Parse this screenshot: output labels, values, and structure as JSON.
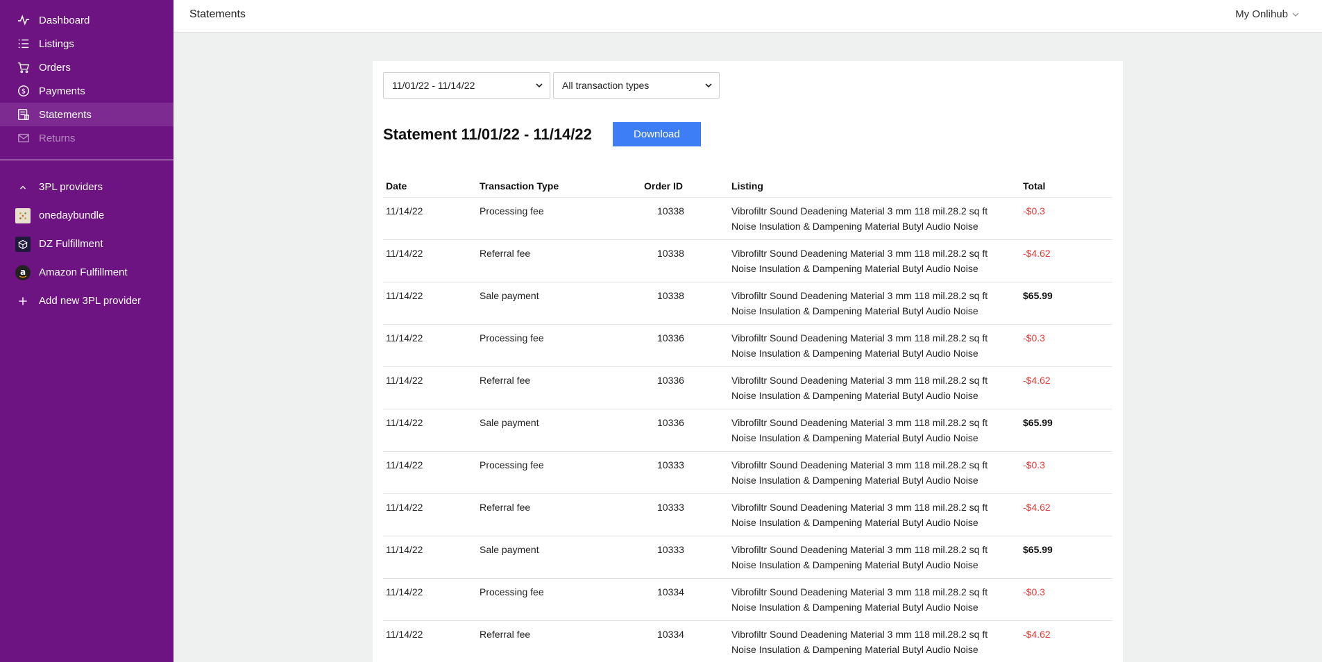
{
  "sidebar": {
    "nav": [
      {
        "label": "Dashboard",
        "icon": "activity-icon"
      },
      {
        "label": "Listings",
        "icon": "list-icon"
      },
      {
        "label": "Orders",
        "icon": "cart-icon"
      },
      {
        "label": "Payments",
        "icon": "dollar-circle-icon"
      },
      {
        "label": "Statements",
        "icon": "statement-icon",
        "active": true
      },
      {
        "label": "Returns",
        "icon": "return-mail-icon",
        "disabled": true
      }
    ],
    "providers_header": "3PL providers",
    "providers": [
      {
        "label": "onedaybundle",
        "icon": "onedaybundle-logo"
      },
      {
        "label": "DZ Fulfillment",
        "icon": "dz-fulfillment-logo"
      },
      {
        "label": "Amazon Fulfillment",
        "icon": "amazon-logo"
      }
    ],
    "add_provider": "Add new 3PL provider"
  },
  "header": {
    "title": "Statements",
    "account": "My Onlihub"
  },
  "filters": {
    "date_range": "11/01/22 - 11/14/22",
    "transaction_type": "All transaction types"
  },
  "statement": {
    "title": "Statement 11/01/22 - 11/14/22",
    "download_label": "Download"
  },
  "table": {
    "headers": [
      "Date",
      "Transaction Type",
      "Order ID",
      "Listing",
      "Total"
    ],
    "rows": [
      {
        "date": "11/14/22",
        "type": "Processing fee",
        "order": "10338",
        "listing_1": "Vibrofiltr Sound Deadening Material 3 mm 118 mil.28.2 sq ft",
        "listing_2": "Noise Insulation & Dampening Material Butyl Audio Noise",
        "total": "-$0.3"
      },
      {
        "date": "11/14/22",
        "type": "Referral fee",
        "order": "10338",
        "listing_1": "Vibrofiltr Sound Deadening Material 3 mm 118 mil.28.2 sq ft",
        "listing_2": "Noise Insulation & Dampening Material Butyl Audio Noise",
        "total": "-$4.62"
      },
      {
        "date": "11/14/22",
        "type": "Sale payment",
        "order": "10338",
        "listing_1": "Vibrofiltr Sound Deadening Material 3 mm 118 mil.28.2 sq ft",
        "listing_2": "Noise Insulation & Dampening Material Butyl Audio Noise",
        "total": "$65.99"
      },
      {
        "date": "11/14/22",
        "type": "Processing fee",
        "order": "10336",
        "listing_1": "Vibrofiltr Sound Deadening Material 3 mm 118 mil.28.2 sq ft",
        "listing_2": "Noise Insulation & Dampening Material Butyl Audio Noise",
        "total": "-$0.3"
      },
      {
        "date": "11/14/22",
        "type": "Referral fee",
        "order": "10336",
        "listing_1": "Vibrofiltr Sound Deadening Material 3 mm 118 mil.28.2 sq ft",
        "listing_2": "Noise Insulation & Dampening Material Butyl Audio Noise",
        "total": "-$4.62"
      },
      {
        "date": "11/14/22",
        "type": "Sale payment",
        "order": "10336",
        "listing_1": "Vibrofiltr Sound Deadening Material 3 mm 118 mil.28.2 sq ft",
        "listing_2": "Noise Insulation & Dampening Material Butyl Audio Noise",
        "total": "$65.99"
      },
      {
        "date": "11/14/22",
        "type": "Processing fee",
        "order": "10333",
        "listing_1": "Vibrofiltr Sound Deadening Material 3 mm 118 mil.28.2 sq ft",
        "listing_2": "Noise Insulation & Dampening Material Butyl Audio Noise",
        "total": "-$0.3"
      },
      {
        "date": "11/14/22",
        "type": "Referral fee",
        "order": "10333",
        "listing_1": "Vibrofiltr Sound Deadening Material 3 mm 118 mil.28.2 sq ft",
        "listing_2": "Noise Insulation & Dampening Material Butyl Audio Noise",
        "total": "-$4.62"
      },
      {
        "date": "11/14/22",
        "type": "Sale payment",
        "order": "10333",
        "listing_1": "Vibrofiltr Sound Deadening Material 3 mm 118 mil.28.2 sq ft",
        "listing_2": "Noise Insulation & Dampening Material Butyl Audio Noise",
        "total": "$65.99"
      },
      {
        "date": "11/14/22",
        "type": "Processing fee",
        "order": "10334",
        "listing_1": "Vibrofiltr Sound Deadening Material 3 mm 118 mil.28.2 sq ft",
        "listing_2": "Noise Insulation & Dampening Material Butyl Audio Noise",
        "total": "-$0.3"
      },
      {
        "date": "11/14/22",
        "type": "Referral fee",
        "order": "10334",
        "listing_1": "Vibrofiltr Sound Deadening Material 3 mm 118 mil.28.2 sq ft",
        "listing_2": "Noise Insulation & Dampening Material Butyl Audio Noise",
        "total": "-$4.62"
      }
    ]
  },
  "colors": {
    "sidebar_bg": "#6d1382",
    "accent_button": "#3d7ef7",
    "negative_amount": "#e53935"
  }
}
